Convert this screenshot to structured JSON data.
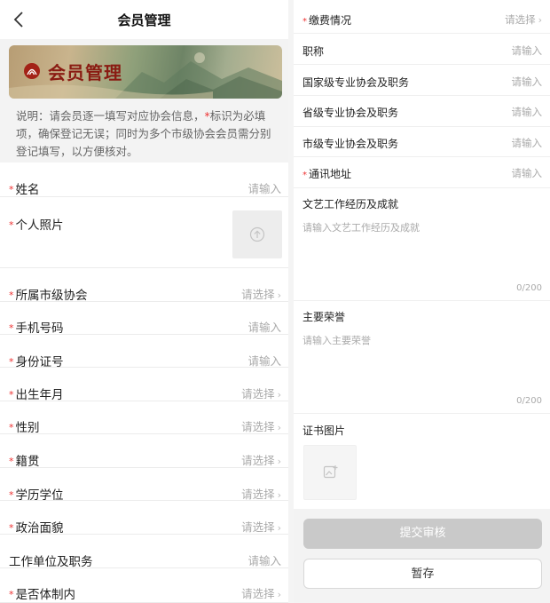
{
  "header": {
    "title": "会员管理"
  },
  "banner": {
    "title": "会员管理"
  },
  "note": {
    "prefix": "说明：请会员逐一填写对应协会信息，",
    "star": "*",
    "suffix": "标识为必填项，确保登记无误；同时为多个市级协会会员需分别登记填写，以方便核对。"
  },
  "form_left": [
    {
      "label": "姓名",
      "required": true,
      "hint": "请输入",
      "arrow": false
    },
    {
      "label": "个人照片",
      "required": true,
      "hint": "",
      "arrow": false
    },
    {
      "label": "所属市级协会",
      "required": true,
      "hint": "请选择",
      "arrow": true
    },
    {
      "label": "手机号码",
      "required": true,
      "hint": "请输入",
      "arrow": false
    },
    {
      "label": "身份证号",
      "required": true,
      "hint": "请输入",
      "arrow": false
    },
    {
      "label": "出生年月",
      "required": true,
      "hint": "请选择",
      "arrow": true
    },
    {
      "label": "性别",
      "required": true,
      "hint": "请选择",
      "arrow": true
    },
    {
      "label": "籍贯",
      "required": true,
      "hint": "请选择",
      "arrow": true
    },
    {
      "label": "学历学位",
      "required": true,
      "hint": "请选择",
      "arrow": true
    },
    {
      "label": "政治面貌",
      "required": true,
      "hint": "请选择",
      "arrow": true
    },
    {
      "label": "工作单位及职务",
      "required": false,
      "hint": "请输入",
      "arrow": false
    },
    {
      "label": "是否体制内",
      "required": true,
      "hint": "请选择",
      "arrow": true
    }
  ],
  "form_right": [
    {
      "label": "缴费情况",
      "required": true,
      "hint": "请选择",
      "arrow": true
    },
    {
      "label": "职称",
      "required": false,
      "hint": "请输入",
      "arrow": false
    },
    {
      "label": "国家级专业协会及职务",
      "required": false,
      "hint": "请输入",
      "arrow": false
    },
    {
      "label": "省级专业协会及职务",
      "required": false,
      "hint": "请输入",
      "arrow": false
    },
    {
      "label": "市级专业协会及职务",
      "required": false,
      "hint": "请输入",
      "arrow": false
    },
    {
      "label": "通讯地址",
      "required": true,
      "hint": "请输入",
      "arrow": false
    }
  ],
  "experience": {
    "label": "文艺工作经历及成就",
    "placeholder": "请输入文艺工作经历及成就",
    "counter": "0/200"
  },
  "honors": {
    "label": "主要荣誉",
    "placeholder": "请输入主要荣誉",
    "counter": "0/200"
  },
  "certificate": {
    "label": "证书图片"
  },
  "actions": {
    "submit": "提交审核",
    "save": "暂存"
  },
  "colors": {
    "required": "#e33333",
    "banner_title": "#8a1b12",
    "submit_disabled": "#c9c9c9"
  }
}
